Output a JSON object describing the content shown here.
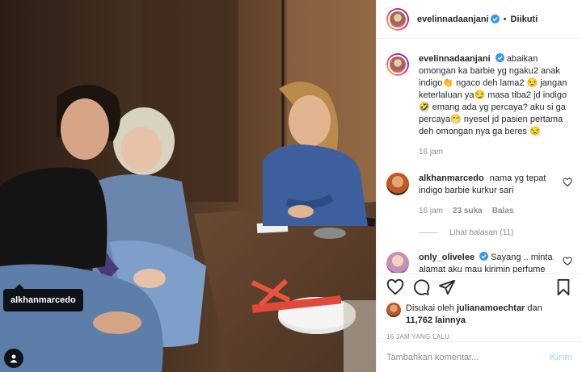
{
  "post": {
    "author": "evelinnadaanjani",
    "follow_separator": "•",
    "follow_status": "Diikuti",
    "caption": "abaikan omongan ka barbie yg ngaku2 anak indigo👏 ngaco deh lama2 😒 jangan keterlaluan ya😏 masa tiba2 jd indigo 🤣 emang ada yg percaya? aku si ga percaya😁 nyesel jd pasien pertama deh omongan nya ga beres 😒",
    "caption_time": "16 jam",
    "photo_tag": "alkhanmarcedo"
  },
  "comments": [
    {
      "username": "alkhanmarcedo",
      "text": "nama yg tepat indigo barbie kurkur sari",
      "time": "16 jam",
      "likes": "23 suka",
      "reply_label": "Balas",
      "view_replies": "Lihat balasan (11)"
    },
    {
      "username": "only_olivelee",
      "text": "Sayang .. minta alamat aku mau kirimin perfume"
    }
  ],
  "likes": {
    "prefix": "Disukai oleh",
    "user": "julianamoechtar",
    "connector": "dan",
    "others": "11,762 lainnya"
  },
  "timestamp": "16 JAM YANG LALU",
  "comment_box": {
    "placeholder": "Tambahkan komentar...",
    "post_label": "Kirim"
  },
  "colors": {
    "verified": "#3897f0",
    "link": "#00376b",
    "post_disabled": "#b2dffc"
  }
}
